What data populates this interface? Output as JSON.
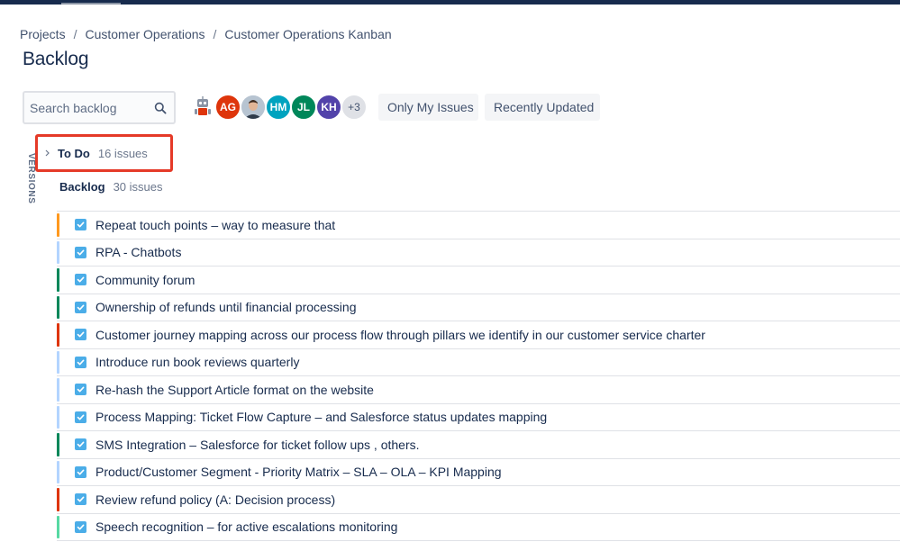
{
  "breadcrumb": [
    "Projects",
    "Customer Operations",
    "Customer Operations Kanban"
  ],
  "page_title": "Backlog",
  "search": {
    "placeholder": "Search backlog",
    "icon": "search-icon"
  },
  "avatars": [
    {
      "kind": "robot",
      "initials": "",
      "color": "#ffffff"
    },
    {
      "kind": "initials",
      "initials": "AG",
      "color": "#de350b"
    },
    {
      "kind": "photo",
      "initials": "",
      "color": "#c9d3dd"
    },
    {
      "kind": "initials",
      "initials": "HM",
      "color": "#00a3bf"
    },
    {
      "kind": "initials",
      "initials": "JL",
      "color": "#00875a"
    },
    {
      "kind": "initials",
      "initials": "KH",
      "color": "#5243aa"
    },
    {
      "kind": "more",
      "initials": "+3",
      "color": "#dfe1e6"
    }
  ],
  "filters": {
    "only_my_issues": "Only My Issues",
    "recently_updated": "Recently Updated"
  },
  "versions_label": "VERSIONS",
  "todo": {
    "name": "To Do",
    "count": "16 issues"
  },
  "backlog": {
    "name": "Backlog",
    "count": "30 issues"
  },
  "issues": [
    {
      "summary": "Repeat touch points – way to measure that",
      "epic_color": "#ff991f"
    },
    {
      "summary": "RPA - Chatbots",
      "epic_color": "#b3d4ff"
    },
    {
      "summary": "Community forum",
      "epic_color": "#00875a"
    },
    {
      "summary": "Ownership of refunds until financial processing",
      "epic_color": "#00875a"
    },
    {
      "summary": "Customer journey mapping across our process flow through pillars we identify in our customer service charter",
      "epic_color": "#de350b"
    },
    {
      "summary": "Introduce run book reviews quarterly",
      "epic_color": "#b3d4ff"
    },
    {
      "summary": "Re-hash the Support Article format on the website",
      "epic_color": "#b3d4ff"
    },
    {
      "summary": "Process Mapping: Ticket Flow Capture – and Salesforce status updates mapping",
      "epic_color": "#b3d4ff"
    },
    {
      "summary": "SMS Integration – Salesforce for ticket follow ups , others.",
      "epic_color": "#00875a"
    },
    {
      "summary": "Product/Customer Segment - Priority Matrix – SLA – OLA – KPI Mapping",
      "epic_color": "#b3d4ff"
    },
    {
      "summary": "Review refund policy (A: Decision process)",
      "epic_color": "#de350b"
    },
    {
      "summary": "Speech recognition – for active escalations monitoring",
      "epic_color": "#57d9a3"
    }
  ]
}
